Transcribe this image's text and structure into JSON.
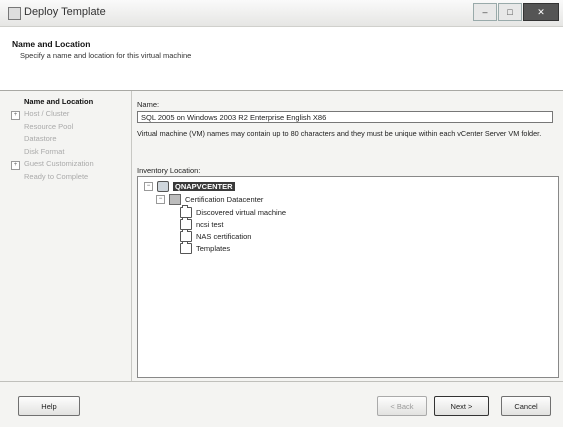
{
  "window": {
    "title": "Deploy Template",
    "minimize_glyph": "–",
    "maximize_glyph": "□",
    "close_glyph": "✕"
  },
  "header": {
    "title": "Name and Location",
    "subtitle": "Specify a name and location for this virtual machine"
  },
  "nav": {
    "items": [
      {
        "label": "Name and Location",
        "active": true
      },
      {
        "label": "Host / Cluster",
        "expander": "+"
      },
      {
        "label": "Resource Pool"
      },
      {
        "label": "Datastore"
      },
      {
        "label": "Disk Format"
      },
      {
        "label": "Guest Customization",
        "expander": "+"
      },
      {
        "label": "Ready to Complete"
      }
    ]
  },
  "form": {
    "name_label": "Name:",
    "name_value": "SQL 2005 on Windows 2003 R2 Enterprise English X86",
    "help_text": "Virtual machine (VM) names may contain up to 80 characters and they must be unique within each vCenter Server VM folder.",
    "inventory_label": "Inventory Location:"
  },
  "tree": {
    "root": {
      "label": "QNAPVCENTER",
      "expander": "−",
      "icon": "vcenter-icon"
    },
    "datacenter": {
      "label": "Certification Datacenter",
      "expander": "−",
      "icon": "datacenter-icon"
    },
    "folders": [
      {
        "label": "Discovered virtual machine",
        "icon": "folder-icon"
      },
      {
        "label": "ncsi test",
        "icon": "folder-icon"
      },
      {
        "label": "NAS certification",
        "icon": "folder-icon"
      },
      {
        "label": "Templates",
        "icon": "folder-icon"
      }
    ]
  },
  "buttons": {
    "help": "Help",
    "back": "< Back",
    "next": "Next >",
    "cancel": "Cancel"
  }
}
